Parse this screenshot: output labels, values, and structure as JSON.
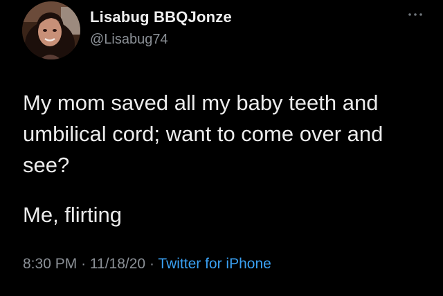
{
  "user": {
    "display_name": "Lisabug BBQJonze",
    "handle": "@Lisabug74"
  },
  "tweet": {
    "text": "My mom saved all my baby teeth and umbilical cord; want to come over and see?",
    "caption": "Me, flirting"
  },
  "meta": {
    "time": "8:30 PM",
    "separator": "·",
    "date": "11/18/20",
    "source": "Twitter for iPhone"
  },
  "icons": {
    "more": "more-dots-icon",
    "avatar": "profile-photo"
  },
  "colors": {
    "background": "#000000",
    "text": "#ececec",
    "secondary": "#8b9096",
    "link": "#3aa0f2"
  }
}
